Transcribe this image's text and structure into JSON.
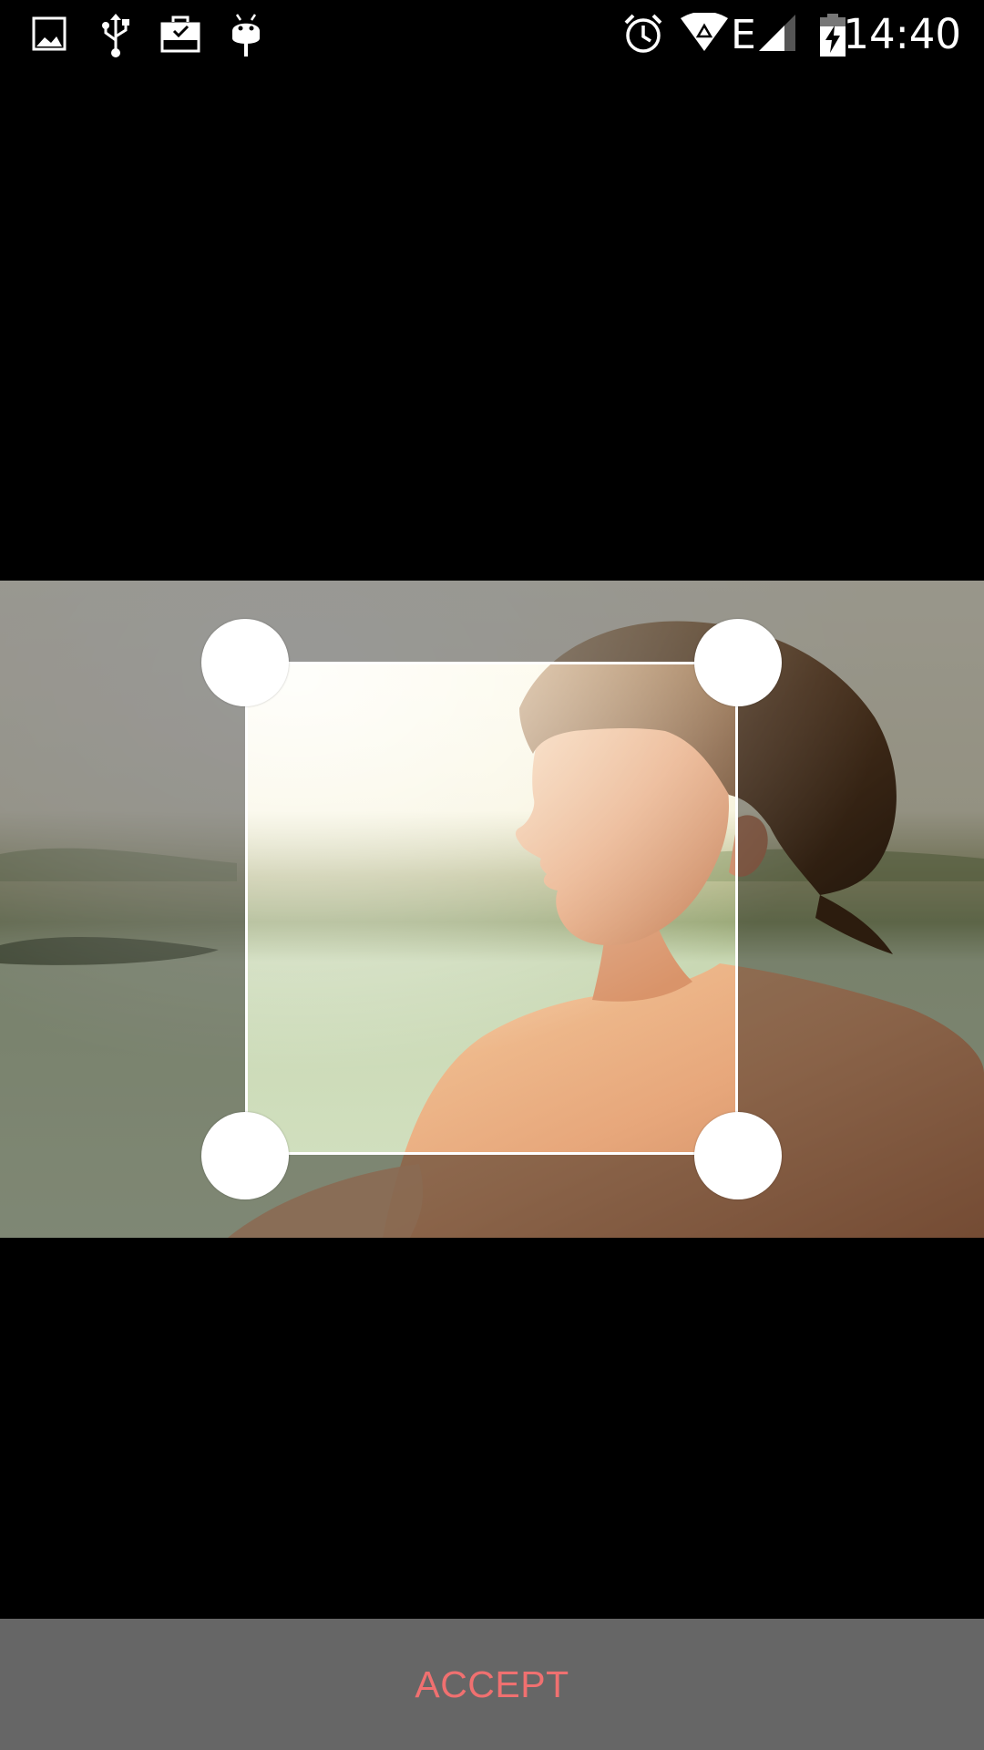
{
  "status_bar": {
    "time": "14:40",
    "network_type": "E",
    "left_icons": [
      "image-icon",
      "usb-icon",
      "briefcase-check-icon",
      "android-debug-icon"
    ],
    "right_icons": [
      "alarm-icon",
      "wifi-icon",
      "network-type-icon",
      "signal-icon",
      "battery-charging-icon"
    ]
  },
  "editor": {
    "mode": "crop",
    "photo_description_icon": "photo-image",
    "handles": [
      "top-left",
      "top-right",
      "bottom-left",
      "bottom-right"
    ]
  },
  "actions": {
    "accept_label": "ACCEPT"
  },
  "colors": {
    "background": "#000000",
    "action_bar": "#666666",
    "accept_text": "#f07070",
    "crop_frame": "#ffffff"
  }
}
